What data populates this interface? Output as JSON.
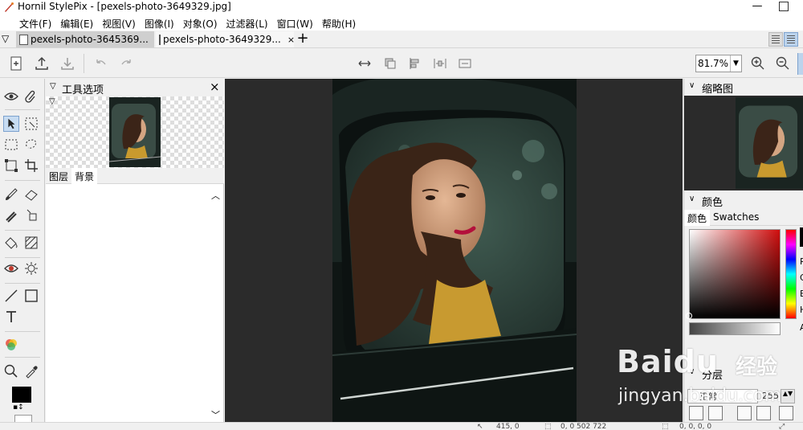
{
  "window": {
    "title": "Hornil StylePix - [pexels-photo-3649329.jpg]"
  },
  "menu": {
    "items": [
      "文件(F)",
      "编辑(E)",
      "视图(V)",
      "图像(I)",
      "对象(O)",
      "过滤器(L)",
      "窗口(W)",
      "帮助(H)"
    ]
  },
  "tabs": [
    {
      "label": "pexels-photo-3645369..."
    },
    {
      "label": "pexels-photo-3649329...",
      "close": "×"
    }
  ],
  "toolbar": {
    "zoom_value": "81.7%"
  },
  "tool_options": {
    "title": "工具选项",
    "close": "×",
    "tabs": [
      "图层",
      "背景"
    ]
  },
  "navigator": {
    "title": "缩略图"
  },
  "color": {
    "title": "颜色",
    "tabs": [
      "颜色",
      "Swatches"
    ],
    "channel_labels": [
      "R",
      "G",
      "B",
      "H",
      "A"
    ]
  },
  "layers": {
    "title": "分层",
    "blend_mode": "正常",
    "opacity": "255"
  },
  "status": {
    "cursor": "415, 0",
    "size": "0, 0 502 722",
    "selection": "0, 0, 0, 0"
  },
  "watermark": {
    "brand": "Baidu",
    "cn": "经验",
    "url": "jingyan.baidu.com"
  },
  "colors": {
    "accent": "#7da2ce",
    "active_tool_bg": "#c7dcf2",
    "canvas_bg": "#2b2b2b",
    "foreground_color": "#000000",
    "background_color": "#ffffff"
  }
}
